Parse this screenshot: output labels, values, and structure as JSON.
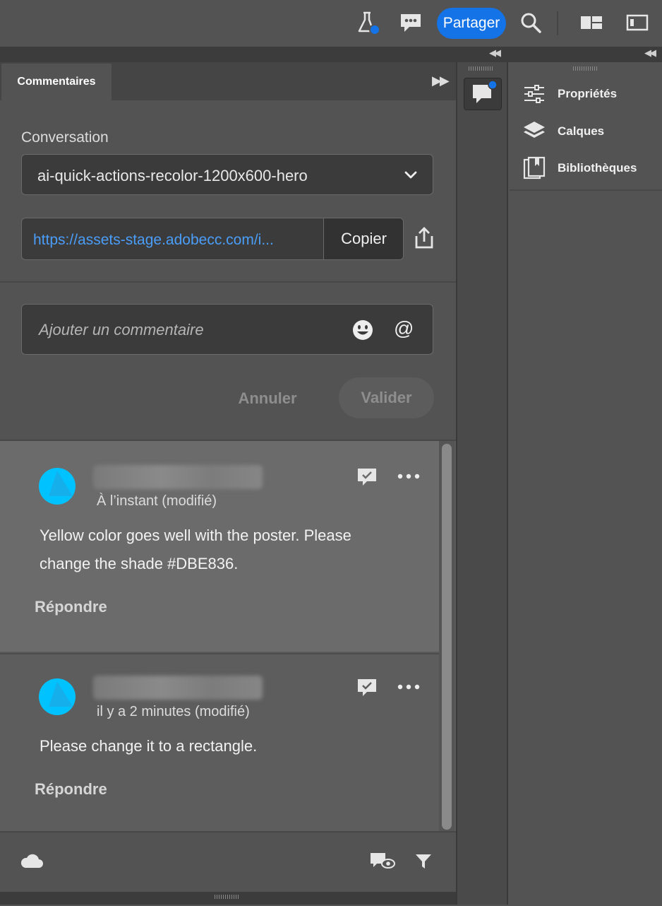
{
  "topbar": {
    "share_label": "Partager",
    "icons": [
      "flask-icon",
      "comments-icon",
      "search-icon",
      "workspace-layout-icon",
      "panel-toggle-icon"
    ],
    "notification_color": "#1473e6"
  },
  "comments_panel": {
    "tab_label": "Commentaires",
    "conversation_label": "Conversation",
    "conversation_value": "ai-quick-actions-recolor-1200x600-hero",
    "link_text": "https://assets-stage.adobecc.com/i...",
    "copy_label": "Copier",
    "comment_placeholder": "Ajouter un commentaire",
    "cancel_label": "Annuler",
    "submit_label": "Valider",
    "comments": [
      {
        "timestamp": "À l’instant (modifié)",
        "text": "Yellow color goes well with the poster. Please change the shade #DBE836.",
        "reply_label": "Répondre"
      },
      {
        "timestamp": "il y a 2 minutes (modifié)",
        "text": "Please change it to a rectangle.",
        "reply_label": "Répondre"
      }
    ]
  },
  "right_panel": {
    "items": [
      {
        "label": "Propriétés",
        "icon": "properties-icon"
      },
      {
        "label": "Calques",
        "icon": "layers-icon"
      },
      {
        "label": "Bibliothèques",
        "icon": "libraries-icon"
      }
    ]
  },
  "colors": {
    "accent": "#1473e6",
    "avatar": "#00c2ff",
    "link": "#4a9df8"
  }
}
